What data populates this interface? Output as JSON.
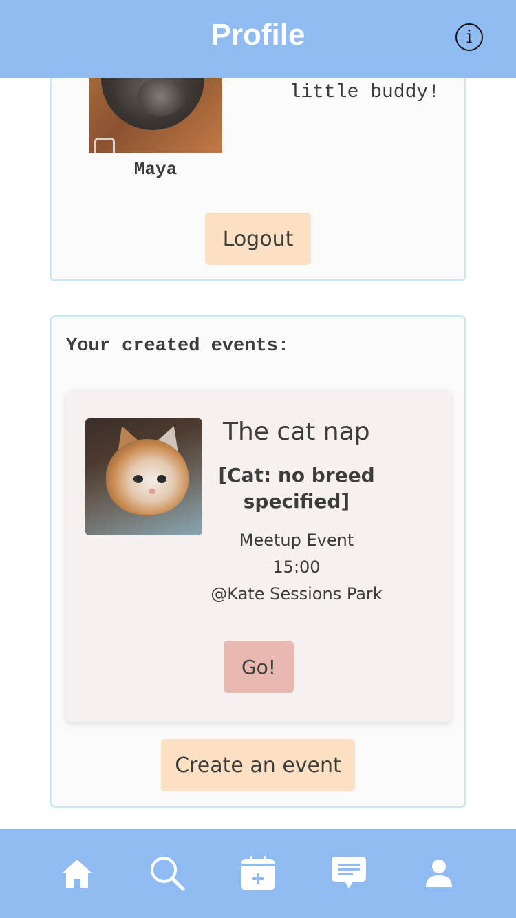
{
  "header": {
    "title": "Profile",
    "info_icon": "info-icon",
    "info_glyph": "i"
  },
  "profile": {
    "pet_name": "Maya",
    "bio_visible_text": "little buddy!",
    "logout_label": "Logout"
  },
  "events": {
    "heading": "Your created events:",
    "items": [
      {
        "title": "The cat nap",
        "breed": "[Cat: no breed specified]",
        "type": "Meetup Event",
        "time": "15:00",
        "location": "@Kate Sessions Park",
        "go_label": "Go!"
      }
    ],
    "create_label": "Create an event"
  },
  "bottom_nav": {
    "items": [
      {
        "icon": "home-icon"
      },
      {
        "icon": "search-icon"
      },
      {
        "icon": "calendar-add-icon"
      },
      {
        "icon": "chat-icon"
      },
      {
        "icon": "user-icon"
      }
    ]
  },
  "colors": {
    "header_bg": "#8fbbf2",
    "card_border": "#cfe7f1",
    "button_peach": "#fbe0c3",
    "go_button": "#e9b8b0",
    "event_card_bg": "#f6f0ef"
  }
}
